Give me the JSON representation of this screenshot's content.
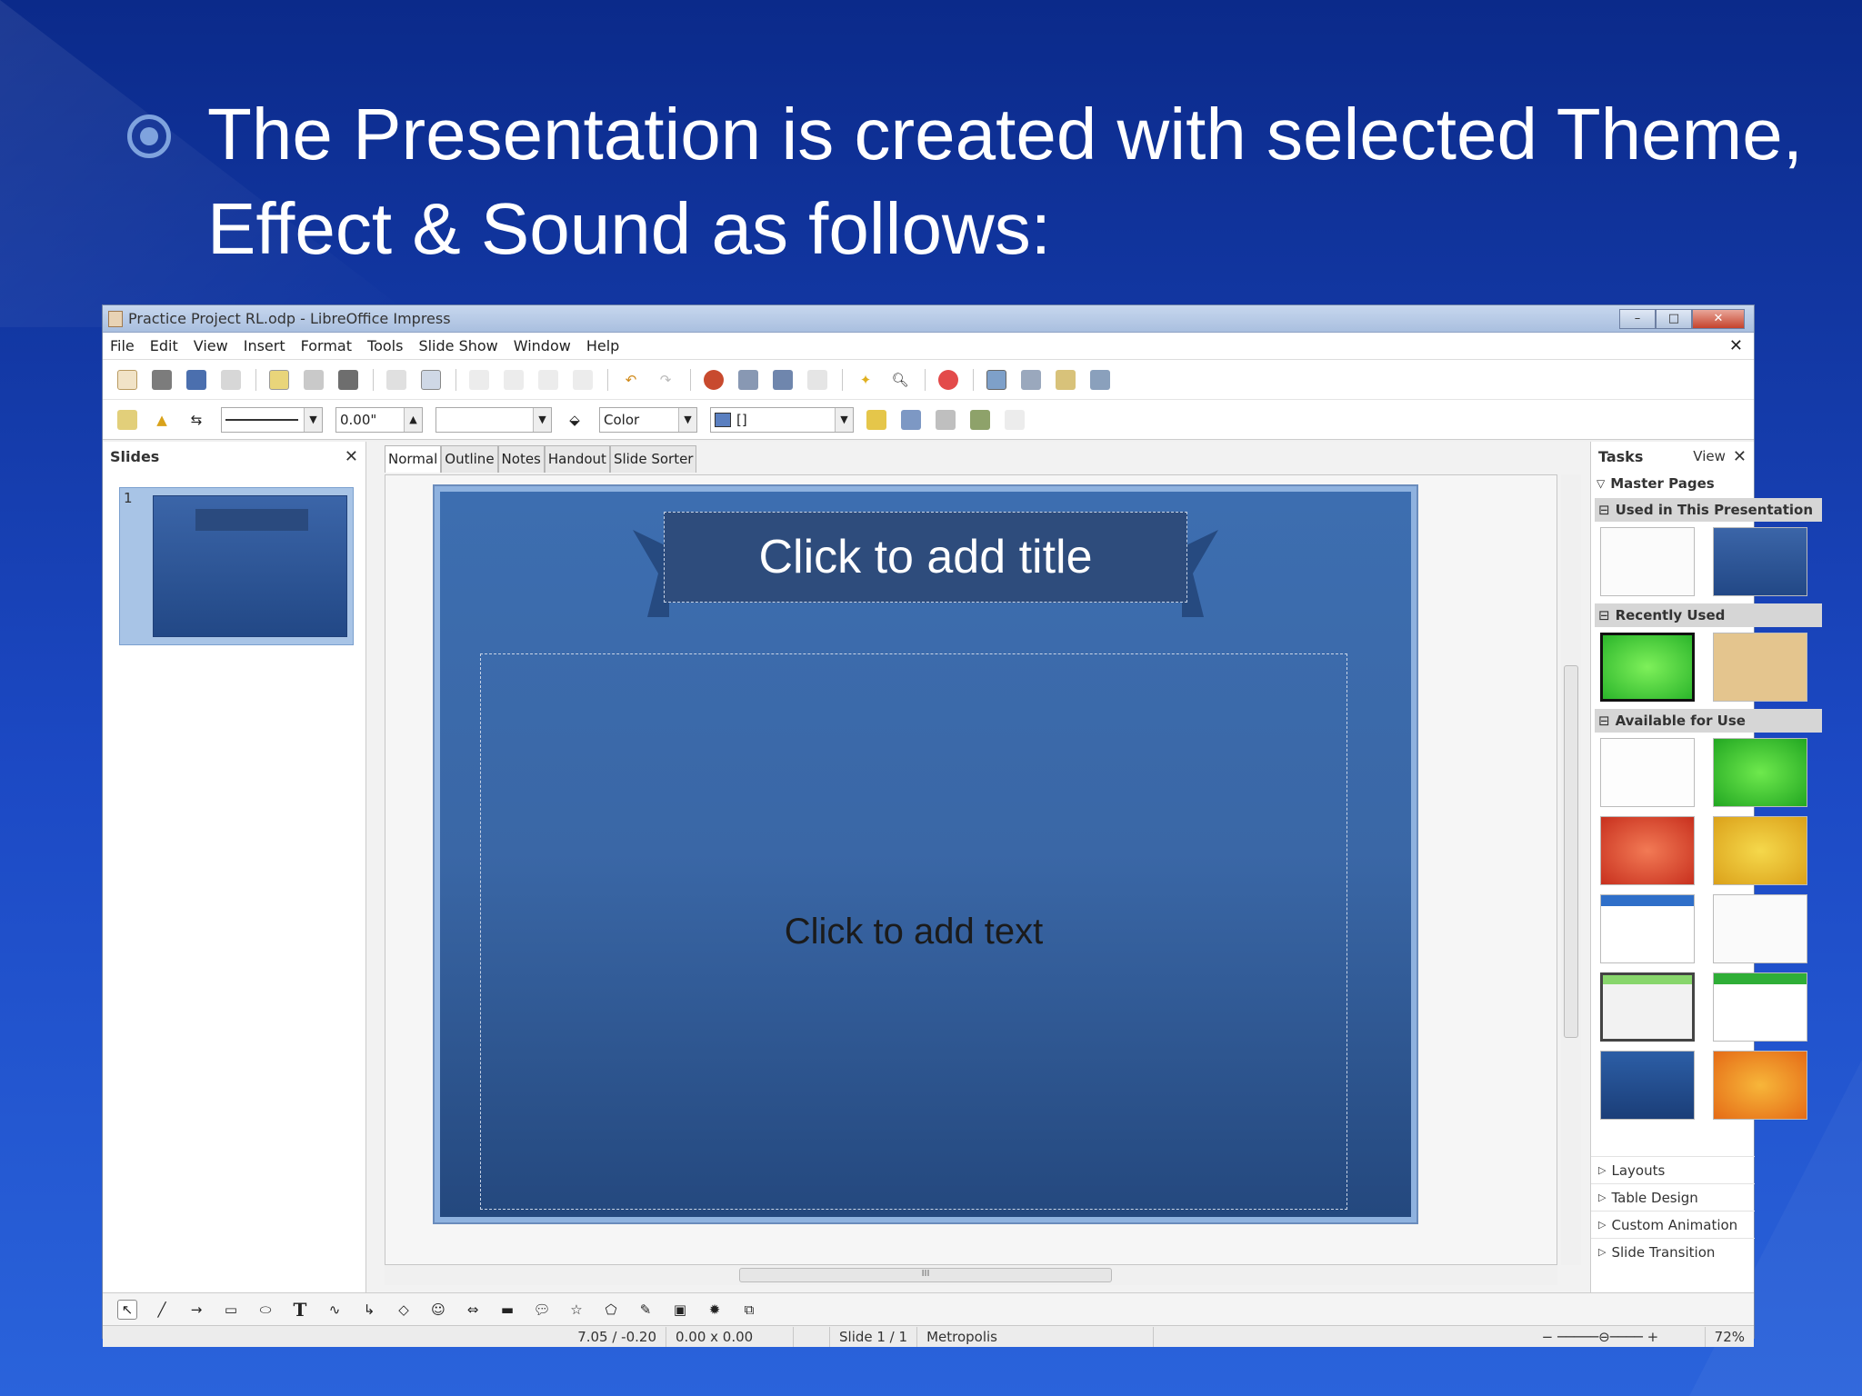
{
  "slide_heading": "The Presentation is created with selected Theme, Effect & Sound as follows:",
  "window": {
    "title": "Practice Project RL.odp - LibreOffice Impress",
    "minimize": "–",
    "maximize": "□",
    "close": "✕"
  },
  "menu": [
    "File",
    "Edit",
    "View",
    "Insert",
    "Format",
    "Tools",
    "Slide Show",
    "Window",
    "Help"
  ],
  "menu_close": "✕",
  "line_style_toolbar": {
    "line_width": "0.00\"",
    "area_style": "Color",
    "area_fill": "[]"
  },
  "slides_pane": {
    "title": "Slides",
    "close": "✕",
    "thumbnails": [
      {
        "number": "1"
      }
    ]
  },
  "view_tabs": [
    "Normal",
    "Outline",
    "Notes",
    "Handout",
    "Slide Sorter"
  ],
  "slide": {
    "title_placeholder": "Click to add title",
    "text_placeholder": "Click to add text"
  },
  "h_scroll_grip": "III",
  "tasks_pane": {
    "title": "Tasks",
    "view": "View",
    "close": "✕",
    "master_pages": "Master Pages",
    "used": "Used in This Presentation",
    "recent": "Recently Used",
    "available": "Available for Use",
    "collapsed_sections": [
      "Layouts",
      "Table Design",
      "Custom Animation",
      "Slide Transition"
    ]
  },
  "status": {
    "position": "7.05 / -0.20",
    "size": "0.00 x 0.00",
    "slide": "Slide 1 / 1",
    "master": "Metropolis",
    "zoom": "72%"
  },
  "colors": {
    "bg_top": "#0b2a8a",
    "bg_bottom": "#2a63db",
    "slide_blue": "#3d6eb0",
    "accent": "#7fa3de"
  }
}
